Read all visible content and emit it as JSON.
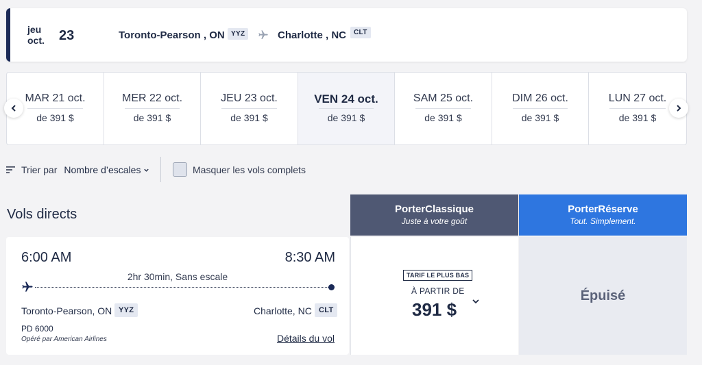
{
  "header": {
    "day_line1": "jeu",
    "day_line2": "oct.",
    "date": "23",
    "origin_city": "Toronto-Pearson , ON",
    "origin_code": "YYZ",
    "destination_city": "Charlotte , NC",
    "destination_code": "CLT"
  },
  "carousel": {
    "dates": [
      {
        "label": "MAR 21 oct.",
        "price": "de 391 $"
      },
      {
        "label": "MER 22 oct.",
        "price": "de 391 $"
      },
      {
        "label": "JEU 23 oct.",
        "price": "de 391 $"
      },
      {
        "label": "VEN 24 oct.",
        "price": "de 391 $",
        "selected": true
      },
      {
        "label": "SAM 25 oct.",
        "price": "de 391 $"
      },
      {
        "label": "DIM 26 oct.",
        "price": "de 391 $"
      },
      {
        "label": "LUN 27 oct.",
        "price": "de 391 $"
      }
    ]
  },
  "sort": {
    "label": "Trier par",
    "value": "Nombre d’escales",
    "hide_full_label": "Masquer les vols complets"
  },
  "section": {
    "title": "Vols directs"
  },
  "fares": {
    "classic": {
      "title": "PorterClassique",
      "subtitle": "Juste à votre goût"
    },
    "reserve": {
      "title": "PorterRéserve",
      "subtitle": "Tout. Simplement."
    }
  },
  "flight": {
    "departure_time": "6:00 AM",
    "arrival_time": "8:30 AM",
    "duration": "2hr 30min, Sans escale",
    "origin_city": "Toronto-Pearson, ON",
    "origin_code": "YYZ",
    "destination_city": "Charlotte, NC",
    "destination_code": "CLT",
    "flight_number": "PD 6000",
    "operated_by": "Opéré par American Airlines",
    "details_link": "Détails du vol"
  },
  "fare_cells": {
    "classic_badge": "TARIF LE PLUS BAS",
    "classic_from": "À PARTIR DE",
    "classic_price": "391 $",
    "reserve_status": "Épuisé"
  },
  "colors": {
    "navy": "#1b2a57",
    "classic_header": "#4f5873",
    "reserve_header": "#2e76e0",
    "background": "#f3f3f5"
  }
}
